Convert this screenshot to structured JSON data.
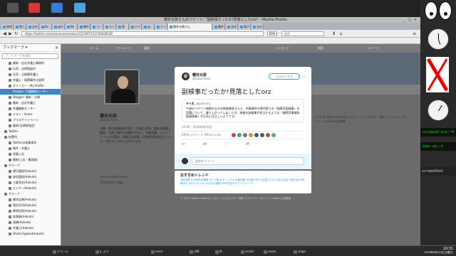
{
  "firefox": {
    "title": "櫻井允政さんのツイート: \"副検事だったか!見落としたorz\" - Mozilla Firefox",
    "url": "https://twitter.com/sakuimasa/status/1025987121506838528",
    "zoom": "90%",
    "search_placeholder": "検索",
    "active_tab": "櫻井允政さん",
    "tabs": [
      "周知",
      "第三",
      "法令",
      "Bc",
      "@hi",
      "Bh",
      "事件",
      "コード",
      "スト",
      "東",
      "ツイ",
      "@",
      "ツイ",
      "櫻井",
      "法学",
      "電子",
      "法学"
    ],
    "bookmarks": [
      "ホーム",
      "モーメント",
      "通知",
      "メッセージ",
      "検索",
      "ツイート"
    ]
  },
  "sidebar": {
    "header": "ブックマーク ▾",
    "search_placeholder": "ブックマークを検索",
    "items": [
      {
        "label": "最新・広沢弁護士事務所",
        "sel": false,
        "indent": 2
      },
      {
        "label": "伝奇・法律相談所",
        "sel": false,
        "indent": 2
      },
      {
        "label": "伝奇・元検事弁護士",
        "sel": false,
        "indent": 2
      },
      {
        "label": "弁護士・冤罪事件の説明",
        "sel": false,
        "indent": 2
      },
      {
        "label": "グリンカー・My Profile",
        "sel": false,
        "indent": 2
      },
      {
        "label": "Blogger: 弁護機能センター",
        "sel": true,
        "indent": 2
      },
      {
        "label": "Blogger: 最新・法律",
        "sel": false,
        "indent": 2
      },
      {
        "label": "最新・広沢弁護士",
        "sel": false,
        "indent": 2
      },
      {
        "label": "弁護機能センター",
        "sel": false,
        "indent": 2
      },
      {
        "label": "テスト・kiroro",
        "sel": false,
        "indent": 2
      },
      {
        "label": "プラスサイトページ",
        "sel": false,
        "indent": 2
      },
      {
        "label": "最新(法律勉強会)",
        "sel": false,
        "indent": 2
      },
      {
        "label": "Twitter",
        "sel": false,
        "indent": 1
      },
      {
        "label": "拘置所",
        "sel": false,
        "indent": 1
      },
      {
        "label": "Twitterの画像保存",
        "sel": false,
        "indent": 2
      },
      {
        "label": "事件・弁護士",
        "sel": false,
        "indent": 2
      },
      {
        "label": "刑事上告",
        "sel": false,
        "indent": 2
      },
      {
        "label": "最新(上告・最高裁)",
        "sel": false,
        "indent": 2
      },
      {
        "label": "グループ",
        "sel": false,
        "indent": 1
      },
      {
        "label": "望月論説(Hokuto)",
        "sel": false,
        "indent": 2
      },
      {
        "label": "安倍論説(Hokuto)",
        "sel": false,
        "indent": 2
      },
      {
        "label": "小倉秀夫(Hokuto)",
        "sel": false,
        "indent": 2
      },
      {
        "label": "モトケン(Hokuto)",
        "sel": false,
        "indent": 2
      },
      {
        "label": "グループ",
        "sel": false,
        "indent": 1
      },
      {
        "label": "橋本広樹(Hokuto)",
        "sel": false,
        "indent": 2
      },
      {
        "label": "落合洋司(Hokuto)",
        "sel": false,
        "indent": 2
      },
      {
        "label": "郷原信郎(Hokuto)",
        "sel": false,
        "indent": 2
      },
      {
        "label": "若狭勝(Hokuto)",
        "sel": false,
        "indent": 2
      },
      {
        "label": "高橋(Hokuto)",
        "sel": false,
        "indent": 2
      },
      {
        "label": "弁護士(Hokuto)",
        "sel": false,
        "indent": 2
      },
      {
        "label": "Shoko Egawa(Hokuto)",
        "sel": false,
        "indent": 2
      }
    ]
  },
  "profile": {
    "name": "櫻井允政",
    "handle": "@sakuimasa",
    "bio": "法曹・東京地検検事を経て、弁護士登録。趣味は読書と散歩、法律と事件の話題を中心に、刑事弁護、ジョン・ヘインズの著作、刑事司法改革、日本版司法取引について、 思うところをつぶやきます。",
    "link": "note.mu/sakuimasa",
    "joined": "2012年2月に登録",
    "right_info": "© 2018 Twitter  Twitterについて  ヘルプセンター  規約  プライバシーポリシー  Cookie  広告情報"
  },
  "modal": {
    "author_name": "櫻井允政",
    "author_handle": "@sakuimasa",
    "follow_label": "フォローする",
    "tweet_text": "副検事だったか!見落としたorz",
    "quote_author": "ヤイ丸",
    "quote_handle": "@yaimaru",
    "quote_text": "今週のイチナイ検察のなかの総務課長さんと、刑事事件の専門家との「検察官副検事」の話題について、盛り上がっていましたが、地検の副検事が担当するような「検察官事務取扱副検事」が正式には正しいようです。",
    "time": "16:00 - 2018年8月6日",
    "stats": "6件のリツイート  9件のいいね",
    "reply_placeholder": "返信をツイート"
  },
  "trends": {
    "title": "おすすめトレンド",
    "items": "#納涼祭  #大雨洪水警報  #ウマ娘  #チームラボ  #東京都  #台風13号  #石原さとみ  #花火大会  #熱中症  #終戦の日  #ポケモンGO  #今日の運勢  #甲子園  #サマーウォーズ"
  },
  "footer": "© 2018 Twitter  Twitterについて  ヘルプセンター  規約  プライバシーポリシー  Cookie  広告情報",
  "taskbar": {
    "items": [
      "アラーム",
      "a_ラク",
      "emac",
      "a88",
      "fb",
      "xclock",
      "xeyes",
      "xlogo"
    ],
    "time": "10:31",
    "date": "2018年8月11日(土曜日)"
  },
  "right_terms": [
    "root@add-pve:~#",
    "screenShot",
    "qemu-wp:~$"
  ],
  "colors": {
    "twitter_blue": "#1da1f2",
    "sidebar_selected": "#3d85c6"
  }
}
